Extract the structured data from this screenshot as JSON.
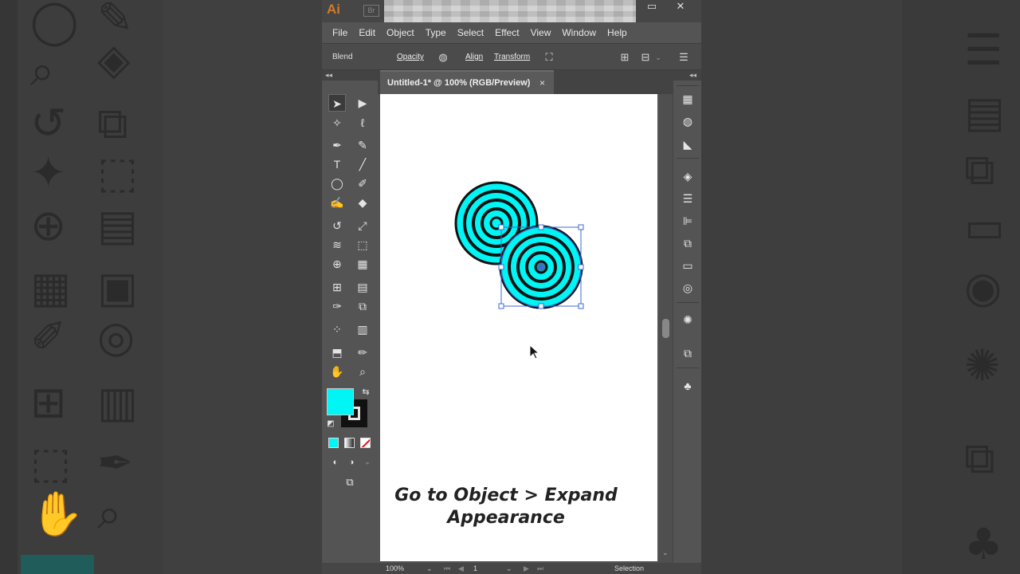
{
  "app": {
    "logo": "Ai",
    "bridge": "Br"
  },
  "window_controls": {
    "minimize": "▭",
    "close": "✕"
  },
  "menubar": [
    "File",
    "Edit",
    "Object",
    "Type",
    "Select",
    "Effect",
    "View",
    "Window",
    "Help"
  ],
  "control_bar": {
    "blend": "Blend",
    "opacity": "Opacity",
    "align": "Align",
    "transform": "Transform"
  },
  "document_tab": {
    "title": "Untitled-1* @ 100% (RGB/Preview)",
    "close": "×"
  },
  "canvas": {
    "caption_line1": "Go to Object > Expand",
    "caption_line2": "Appearance"
  },
  "colors": {
    "fill": "#00f5f5",
    "stroke": "#111111",
    "selection": "#3b6bd6"
  },
  "status": {
    "zoom": "100%",
    "artboard": "1",
    "tool": "Selection"
  }
}
